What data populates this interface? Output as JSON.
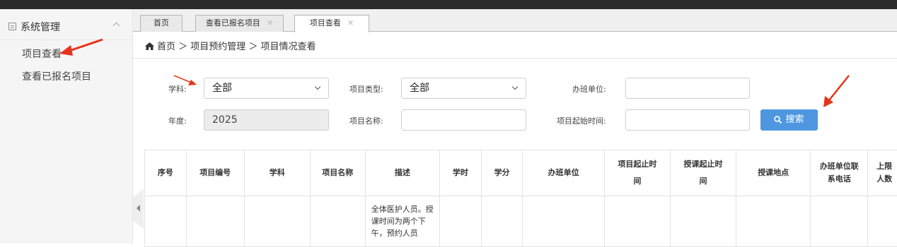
{
  "sidebar": {
    "title": "系统管理",
    "items": [
      {
        "label": "项目查看"
      },
      {
        "label": "查看已报名项目"
      }
    ]
  },
  "tabs": [
    {
      "label": "首页"
    },
    {
      "label": "查看已报名项目"
    },
    {
      "label": "项目查看"
    }
  ],
  "breadcrumb": {
    "text": "首页 ＞ 项目预约管理 ＞ 项目情况查看"
  },
  "filters": {
    "subject": {
      "label": "学科:",
      "value": "全部"
    },
    "project_type": {
      "label": "项目类型:",
      "value": "全部"
    },
    "organizer": {
      "label": "办班单位:",
      "value": ""
    },
    "year": {
      "label": "年度:",
      "value": "2025"
    },
    "project_name": {
      "label": "项目名称:",
      "value": ""
    },
    "start_time": {
      "label": "项目起始时间:",
      "value": ""
    },
    "search_label": "搜索"
  },
  "table": {
    "headers": [
      "序号",
      "项目编号",
      "学科",
      "项目名称",
      "描述",
      "学时",
      "学分",
      "办班单位",
      "项目起止时间",
      "授课起止时间",
      "授课地点",
      "办班单位联系电话",
      "上限人数"
    ],
    "rows": [
      [
        "",
        "",
        "",
        "",
        "全体医护人员。授课时间为两个下午，预约人员",
        "",
        "",
        "",
        "",
        "",
        "",
        "",
        ""
      ]
    ]
  },
  "colors": {
    "accent": "#4e97e0",
    "annotation": "#e8331c"
  }
}
